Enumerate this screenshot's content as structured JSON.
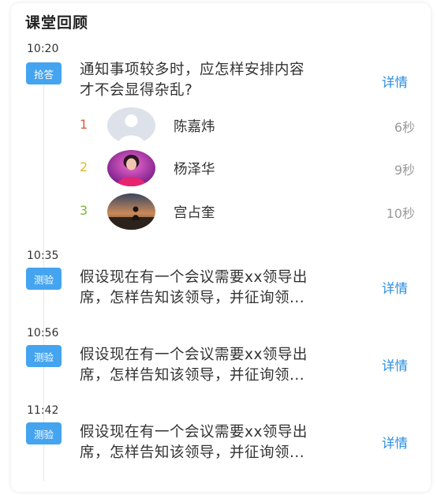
{
  "section_title": "课堂回顾",
  "colors": {
    "badge_bg": "#45a4f0",
    "link": "#2b8ee0",
    "rank_1": "#e0593f",
    "rank_2": "#e2b62c",
    "rank_3": "#7ab83a",
    "muted": "#9a9a9a"
  },
  "entries": [
    {
      "time": "10:20",
      "badge": "抢答",
      "question_line1": "通知事项较多时，应怎样安排内容",
      "question_line2": "才不会显得杂乱?",
      "detail": "详情",
      "answers": [
        {
          "rank": "1",
          "name": "陈嘉炜",
          "time": "6秒",
          "avatar": "default-avatar"
        },
        {
          "rank": "2",
          "name": "杨泽华",
          "time": "9秒",
          "avatar": "photo-avatar-woman"
        },
        {
          "rank": "3",
          "name": "宫占奎",
          "time": "10秒",
          "avatar": "photo-avatar-sunset"
        }
      ]
    },
    {
      "time": "10:35",
      "badge": "测验",
      "question_line1": "假设现在有一个会议需要xx领导出",
      "question_line2": "席，怎样告知该领导，并征询领...",
      "detail": "详情"
    },
    {
      "time": "10:56",
      "badge": "测验",
      "question_line1": "假设现在有一个会议需要xx领导出",
      "question_line2": "席，怎样告知该领导，并征询领...",
      "detail": "详情"
    },
    {
      "time": "11:42",
      "badge": "测验",
      "question_line1": "假设现在有一个会议需要xx领导出",
      "question_line2": "席，怎样告知该领导，并征询领...",
      "detail": "详情"
    }
  ]
}
